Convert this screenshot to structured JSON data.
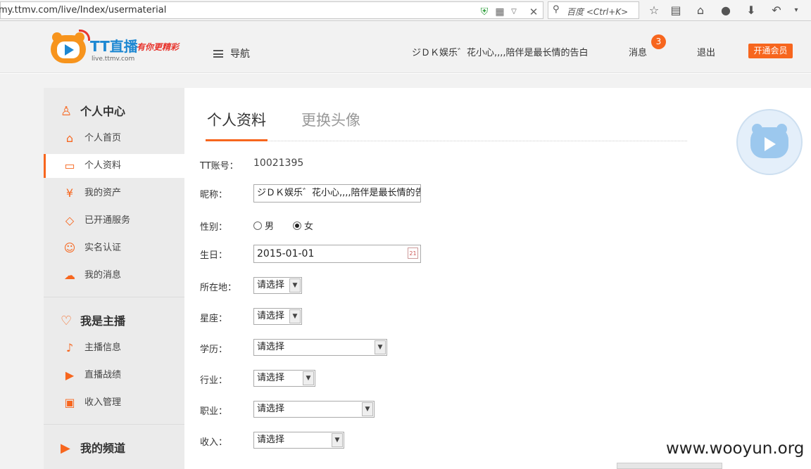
{
  "browser": {
    "url": "my.ttmv.com/live/Index/usermaterial",
    "search_placeholder": "百度 <Ctrl+K>"
  },
  "header": {
    "logo_title": "TT直播",
    "logo_slogan": "有你更精彩",
    "logo_domain": "live.ttmv.com",
    "nav_label": "导航",
    "username": "ジＤＫ娱乐゛花小心,,,,陪伴是最长情的告白",
    "messages_label": "消息",
    "messages_count": "3",
    "logout_label": "退出",
    "vip_label": "开通会员"
  },
  "sidebar": {
    "personal_center": {
      "title": "个人中心",
      "items": [
        {
          "label": "个人首页",
          "icon": "home-icon"
        },
        {
          "label": "个人资料",
          "icon": "id-card-icon"
        },
        {
          "label": "我的资产",
          "icon": "yen-icon"
        },
        {
          "label": "已开通服务",
          "icon": "diamond-icon"
        },
        {
          "label": "实名认证",
          "icon": "face-icon"
        },
        {
          "label": "我的消息",
          "icon": "chat-icon"
        }
      ]
    },
    "host": {
      "title": "我是主播",
      "items": [
        {
          "label": "主播信息",
          "icon": "microphone-icon"
        },
        {
          "label": "直播战绩",
          "icon": "video-camera-icon"
        },
        {
          "label": "收入管理",
          "icon": "wallet-icon"
        }
      ]
    },
    "channel": {
      "title": "我的频道"
    }
  },
  "tabs": {
    "profile": "个人资料",
    "avatar": "更换头像"
  },
  "form": {
    "account_label": "TT账号：",
    "account_value": "10021395",
    "nickname_label": "昵称：",
    "nickname_value": "ジＤＫ娱乐゛花小心,,,,陪伴是最长情的告白",
    "gender_label": "性别：",
    "gender_male": "男",
    "gender_female": "女",
    "gender_selected": "女",
    "birthday_label": "生日：",
    "birthday_value": "2015-01-01",
    "location_label": "所在地：",
    "location_value": "请选择",
    "zodiac_label": "星座：",
    "zodiac_value": "请选择",
    "education_label": "学历：",
    "education_value": "请选择",
    "industry_label": "行业：",
    "industry_value": "请选择",
    "occupation_label": "职业：",
    "occupation_value": "请选择",
    "income_label": "收入：",
    "income_value": "请选择"
  },
  "watermark": "www.wooyun.org",
  "colors": {
    "accent": "#f7661e",
    "logo_blue": "#1e88d2"
  }
}
